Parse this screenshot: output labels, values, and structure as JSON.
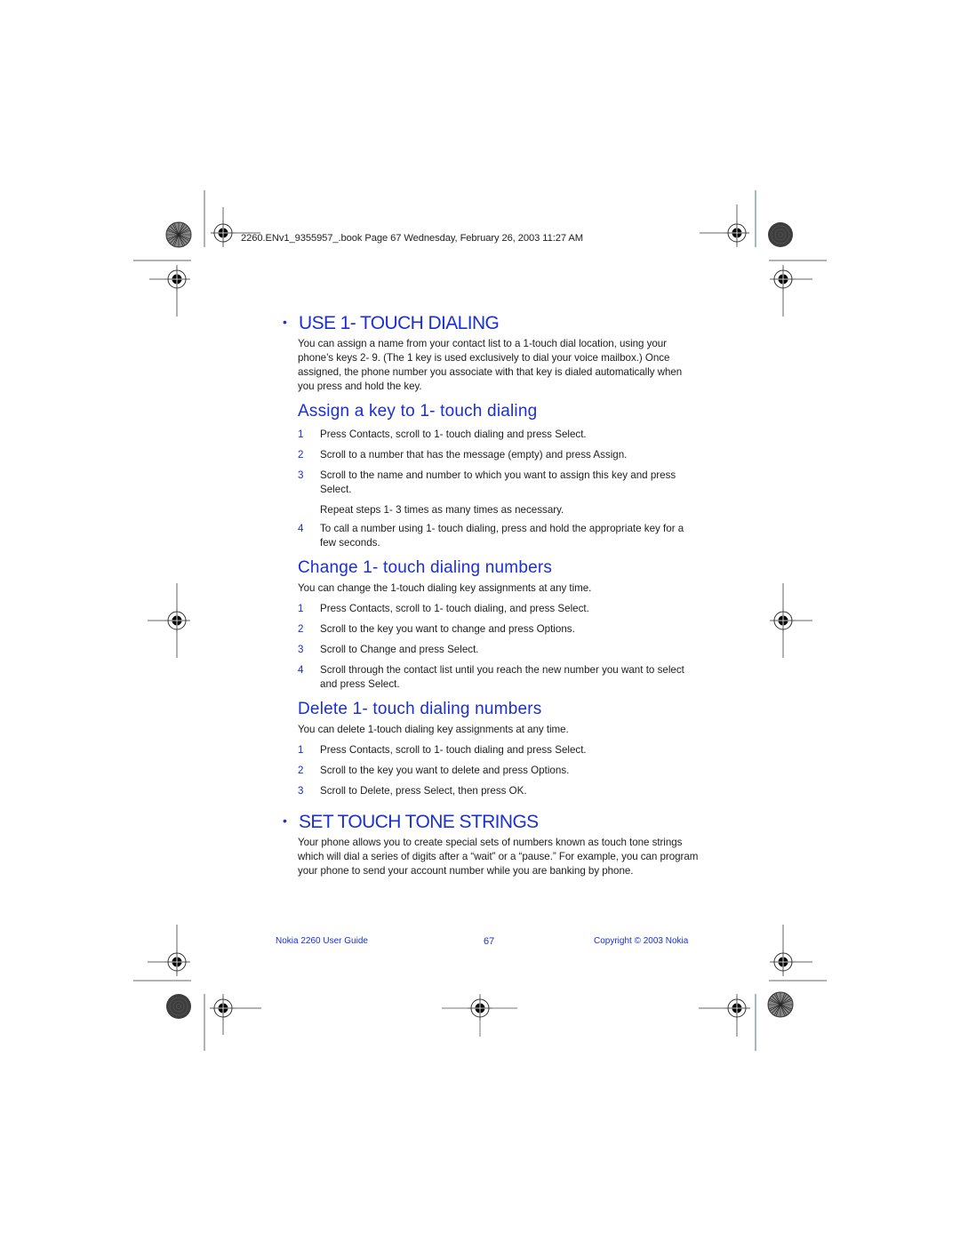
{
  "header": {
    "file_info": "2260.ENv1_9355957_.book  Page 67  Wednesday, February 26, 2003  11:27 AM"
  },
  "sections": {
    "use_1touch": {
      "bullet": "•",
      "title": "USE 1- TOUCH DIALING",
      "intro": "You can assign a name from your contact list to a 1-touch dial location, using your phone’s keys 2- 9. (The 1 key is used exclusively to dial your voice mailbox.) Once assigned, the phone number you associate with that key is dialed automatically when you press and hold the key."
    },
    "assign": {
      "title": "Assign a key to 1- touch dialing",
      "steps": [
        {
          "num": "1",
          "text": "Press Contacts, scroll to 1- touch dialing and press Select."
        },
        {
          "num": "2",
          "text": "Scroll to a number that has the message (empty) and press Assign."
        },
        {
          "num": "3",
          "text": "Scroll to the name and number to which you want to assign this key and press Select."
        },
        {
          "num": "4",
          "text": "To call a number using 1- touch dialing, press and hold the appropriate key for a few seconds."
        }
      ],
      "note": "Repeat steps 1- 3 times as many times as necessary."
    },
    "change": {
      "title": "Change 1- touch dialing numbers",
      "intro": "You can change the 1-touch dialing key assignments at any time.",
      "steps": [
        {
          "num": "1",
          "text": "Press Contacts, scroll to 1- touch dialing, and press Select."
        },
        {
          "num": "2",
          "text": "Scroll to the key you want to change and press Options."
        },
        {
          "num": "3",
          "text": "Scroll to Change and press Select."
        },
        {
          "num": "4",
          "text": "Scroll through the contact list until you reach the new number you want to select and press Select."
        }
      ]
    },
    "delete": {
      "title": "Delete 1- touch dialing numbers",
      "intro": "You can delete 1-touch dialing key assignments at any time.",
      "steps": [
        {
          "num": "1",
          "text": "Press Contacts, scroll to 1- touch dialing and press Select."
        },
        {
          "num": "2",
          "text": "Scroll to the key you want to delete and press Options."
        },
        {
          "num": "3",
          "text": "Scroll to Delete, press Select, then press OK."
        }
      ]
    },
    "tone_strings": {
      "bullet": "•",
      "title": "SET TOUCH TONE STRINGS",
      "intro": "Your phone allows you to create special sets of numbers known as touch tone strings which will dial a series of digits after a “wait” or a “pause.” For example, you can program your phone to send your account number while you are banking by phone."
    }
  },
  "footer": {
    "guide_title": "Nokia 2260 User Guide",
    "page_number": "67",
    "copyright": "Copyright © 2003 Nokia"
  },
  "colors": {
    "accent": "#1a2fd6",
    "body_text": "#1d1d1d"
  }
}
